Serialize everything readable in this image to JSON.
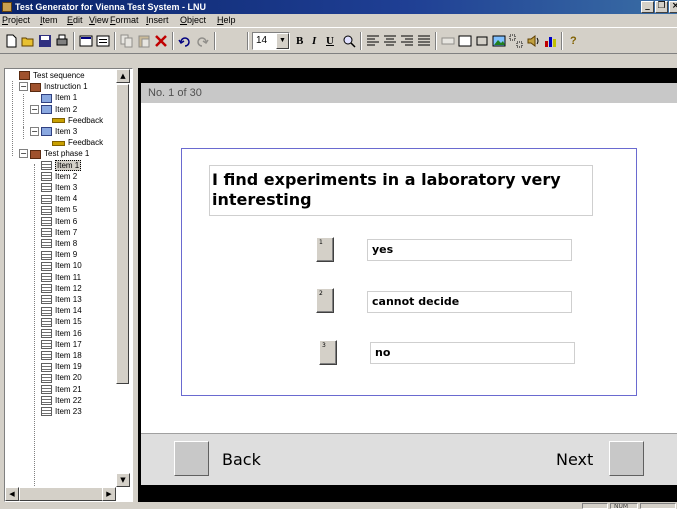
{
  "window": {
    "title": "Test Generator for Vienna Test System - LNU",
    "min_glyph": "_",
    "max_glyph": "❐",
    "close_glyph": "×"
  },
  "menu": [
    "Project",
    "Item",
    "Edit",
    "View",
    "Format",
    "Insert",
    "Object",
    "Help"
  ],
  "toolbar": {
    "font_size": "14",
    "dropdown_glyph": "▼",
    "bold": "B",
    "italic": "I",
    "underline": "U",
    "help_glyph": "?"
  },
  "tree": {
    "collapse_glyph": "−",
    "nodes": [
      {
        "label": "Test sequence",
        "kind": "book"
      },
      {
        "label": "Instruction 1",
        "kind": "book"
      },
      {
        "label": "Item 1",
        "kind": "inst"
      },
      {
        "label": "Item 2",
        "kind": "inst"
      },
      {
        "label": "Feedback",
        "kind": "fb"
      },
      {
        "label": "Item 3",
        "kind": "inst"
      },
      {
        "label": "Feedback",
        "kind": "fb"
      },
      {
        "label": "Test phase 1",
        "kind": "book"
      },
      {
        "label": "Item 1",
        "kind": "page",
        "selected": true
      },
      {
        "label": "Item 2",
        "kind": "page"
      },
      {
        "label": "Item 3",
        "kind": "page"
      },
      {
        "label": "Item 4",
        "kind": "page"
      },
      {
        "label": "Item 5",
        "kind": "page"
      },
      {
        "label": "Item 6",
        "kind": "page"
      },
      {
        "label": "Item 7",
        "kind": "page"
      },
      {
        "label": "Item 8",
        "kind": "page"
      },
      {
        "label": "Item 9",
        "kind": "page"
      },
      {
        "label": "Item 10",
        "kind": "page"
      },
      {
        "label": "Item 11",
        "kind": "page"
      },
      {
        "label": "Item 12",
        "kind": "page"
      },
      {
        "label": "Item 13",
        "kind": "page"
      },
      {
        "label": "Item 14",
        "kind": "page"
      },
      {
        "label": "Item 15",
        "kind": "page"
      },
      {
        "label": "Item 16",
        "kind": "page"
      },
      {
        "label": "Item 17",
        "kind": "page"
      },
      {
        "label": "Item 18",
        "kind": "page"
      },
      {
        "label": "Item 19",
        "kind": "page"
      },
      {
        "label": "Item 20",
        "kind": "page"
      },
      {
        "label": "Item 21",
        "kind": "page"
      },
      {
        "label": "Item 22",
        "kind": "page"
      },
      {
        "label": "Item 23",
        "kind": "page"
      }
    ],
    "scroll_up": "▲",
    "scroll_down": "▼",
    "scroll_left": "◀",
    "scroll_right": "▶"
  },
  "preview": {
    "item_counter": "No. 1 of 30",
    "question": "I find experiments in a laboratory very interesting",
    "options": [
      {
        "number": "1",
        "label": "yes"
      },
      {
        "number": "2",
        "label": "cannot decide"
      },
      {
        "number": "3",
        "label": "no"
      }
    ],
    "back_label": "Back",
    "next_label": "Next"
  },
  "statusbar": {
    "num": "NUM"
  }
}
